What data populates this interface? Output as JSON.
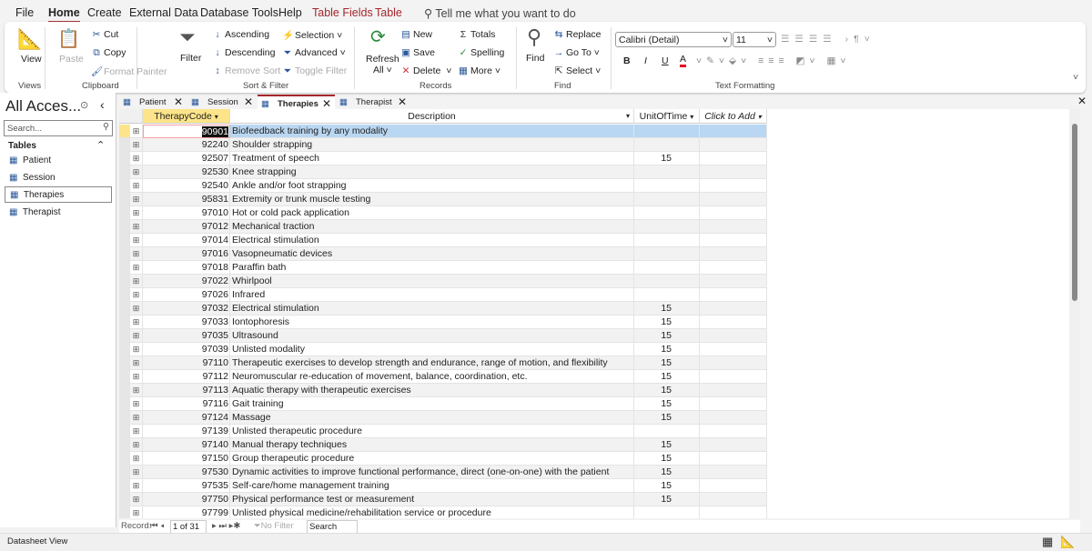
{
  "menu": {
    "file": "File",
    "home": "Home",
    "create": "Create",
    "external": "External Data",
    "dbtools": "Database Tools",
    "help": "Help",
    "table_fields": "Table Fields",
    "table": "Table",
    "tell_me": "Tell me what you want to do"
  },
  "ribbon": {
    "views": {
      "view": "View",
      "label": "Views"
    },
    "clipboard": {
      "paste": "Paste",
      "cut": "Cut",
      "copy": "Copy",
      "format_painter": "Format Painter",
      "label": "Clipboard"
    },
    "sort_filter": {
      "filter": "Filter",
      "ascending": "Ascending",
      "descending": "Descending",
      "remove_sort": "Remove Sort",
      "selection": "Selection",
      "advanced": "Advanced",
      "toggle_filter": "Toggle Filter",
      "label": "Sort & Filter"
    },
    "records": {
      "refresh": "Refresh",
      "all": "All",
      "new": "New",
      "save": "Save",
      "delete": "Delete",
      "totals": "Totals",
      "spelling": "Spelling",
      "more": "More",
      "label": "Records"
    },
    "find": {
      "find": "Find",
      "replace": "Replace",
      "goto": "Go To",
      "select": "Select",
      "label": "Find"
    },
    "text_formatting": {
      "font": "Calibri (Detail)",
      "size": "11",
      "label": "Text Formatting",
      "bold": "B",
      "italic": "I",
      "underline": "U",
      "font_color": "A",
      "font_color_hex": "#e81123"
    }
  },
  "nav": {
    "title": "All Acces...",
    "search_placeholder": "Search...",
    "section": "Tables",
    "items": [
      "Patient",
      "Session",
      "Therapies",
      "Therapist"
    ],
    "selected": "Therapies"
  },
  "tabs": [
    {
      "label": "Patient"
    },
    {
      "label": "Session"
    },
    {
      "label": "Therapies",
      "active": true
    },
    {
      "label": "Therapist"
    }
  ],
  "table": {
    "columns": [
      "TherapyCode",
      "Description",
      "UnitOfTime",
      "Click to Add"
    ],
    "rows": [
      [
        "90901",
        "Biofeedback training by any modality",
        ""
      ],
      [
        "92240",
        "Shoulder strapping",
        ""
      ],
      [
        "92507",
        "Treatment of speech",
        "15"
      ],
      [
        "92530",
        "Knee strapping",
        ""
      ],
      [
        "92540",
        "Ankle and/or foot strapping",
        ""
      ],
      [
        "95831",
        "Extremity or trunk muscle testing",
        ""
      ],
      [
        "97010",
        "Hot or cold pack application",
        ""
      ],
      [
        "97012",
        "Mechanical traction",
        ""
      ],
      [
        "97014",
        "Electrical stimulation",
        ""
      ],
      [
        "97016",
        "Vasopneumatic devices",
        ""
      ],
      [
        "97018",
        "Paraffin bath",
        ""
      ],
      [
        "97022",
        "Whirlpool",
        ""
      ],
      [
        "97026",
        "Infrared",
        ""
      ],
      [
        "97032",
        "Electrical stimulation",
        "15"
      ],
      [
        "97033",
        "Iontophoresis",
        "15"
      ],
      [
        "97035",
        "Ultrasound",
        "15"
      ],
      [
        "97039",
        "Unlisted modality",
        "15"
      ],
      [
        "97110",
        "Therapeutic exercises to develop strength and endurance, range of motion, and flexibility",
        "15"
      ],
      [
        "97112",
        "Neuromuscular re-education of movement, balance, coordination, etc.",
        "15"
      ],
      [
        "97113",
        "Aquatic therapy with therapeutic exercises",
        "15"
      ],
      [
        "97116",
        "Gait training",
        "15"
      ],
      [
        "97124",
        "Massage",
        "15"
      ],
      [
        "97139",
        "Unlisted therapeutic procedure",
        ""
      ],
      [
        "97140",
        "Manual therapy techniques",
        "15"
      ],
      [
        "97150",
        "Group therapeutic procedure",
        "15"
      ],
      [
        "97530",
        "Dynamic activities to improve functional performance, direct (one-on-one) with the patient",
        "15"
      ],
      [
        "97535",
        "Self-care/home management training",
        "15"
      ],
      [
        "97750",
        "Physical performance test or measurement",
        "15"
      ],
      [
        "97799",
        "Unlisted physical medicine/rehabilitation service or procedure",
        ""
      ]
    ]
  },
  "record_nav": {
    "label": "Record:",
    "position": "1 of 31",
    "no_filter": "No Filter",
    "search": "Search"
  },
  "status": {
    "view": "Datasheet View"
  }
}
